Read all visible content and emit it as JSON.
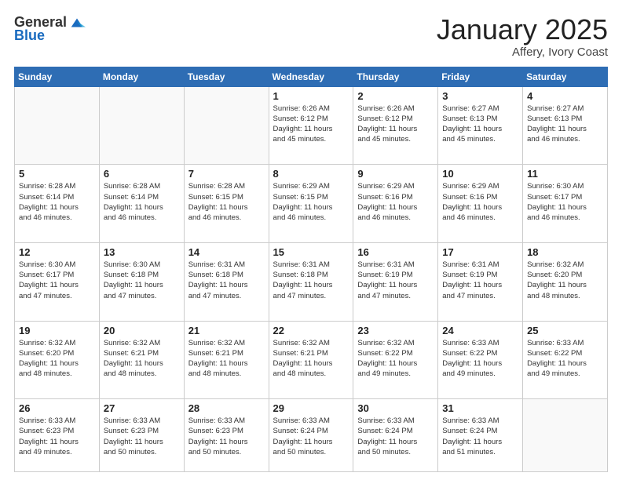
{
  "header": {
    "logo_general": "General",
    "logo_blue": "Blue",
    "title": "January 2025",
    "location": "Affery, Ivory Coast"
  },
  "weekdays": [
    "Sunday",
    "Monday",
    "Tuesday",
    "Wednesday",
    "Thursday",
    "Friday",
    "Saturday"
  ],
  "weeks": [
    [
      {
        "day": "",
        "info": ""
      },
      {
        "day": "",
        "info": ""
      },
      {
        "day": "",
        "info": ""
      },
      {
        "day": "1",
        "info": "Sunrise: 6:26 AM\nSunset: 6:12 PM\nDaylight: 11 hours\nand 45 minutes."
      },
      {
        "day": "2",
        "info": "Sunrise: 6:26 AM\nSunset: 6:12 PM\nDaylight: 11 hours\nand 45 minutes."
      },
      {
        "day": "3",
        "info": "Sunrise: 6:27 AM\nSunset: 6:13 PM\nDaylight: 11 hours\nand 45 minutes."
      },
      {
        "day": "4",
        "info": "Sunrise: 6:27 AM\nSunset: 6:13 PM\nDaylight: 11 hours\nand 46 minutes."
      }
    ],
    [
      {
        "day": "5",
        "info": "Sunrise: 6:28 AM\nSunset: 6:14 PM\nDaylight: 11 hours\nand 46 minutes."
      },
      {
        "day": "6",
        "info": "Sunrise: 6:28 AM\nSunset: 6:14 PM\nDaylight: 11 hours\nand 46 minutes."
      },
      {
        "day": "7",
        "info": "Sunrise: 6:28 AM\nSunset: 6:15 PM\nDaylight: 11 hours\nand 46 minutes."
      },
      {
        "day": "8",
        "info": "Sunrise: 6:29 AM\nSunset: 6:15 PM\nDaylight: 11 hours\nand 46 minutes."
      },
      {
        "day": "9",
        "info": "Sunrise: 6:29 AM\nSunset: 6:16 PM\nDaylight: 11 hours\nand 46 minutes."
      },
      {
        "day": "10",
        "info": "Sunrise: 6:29 AM\nSunset: 6:16 PM\nDaylight: 11 hours\nand 46 minutes."
      },
      {
        "day": "11",
        "info": "Sunrise: 6:30 AM\nSunset: 6:17 PM\nDaylight: 11 hours\nand 46 minutes."
      }
    ],
    [
      {
        "day": "12",
        "info": "Sunrise: 6:30 AM\nSunset: 6:17 PM\nDaylight: 11 hours\nand 47 minutes."
      },
      {
        "day": "13",
        "info": "Sunrise: 6:30 AM\nSunset: 6:18 PM\nDaylight: 11 hours\nand 47 minutes."
      },
      {
        "day": "14",
        "info": "Sunrise: 6:31 AM\nSunset: 6:18 PM\nDaylight: 11 hours\nand 47 minutes."
      },
      {
        "day": "15",
        "info": "Sunrise: 6:31 AM\nSunset: 6:18 PM\nDaylight: 11 hours\nand 47 minutes."
      },
      {
        "day": "16",
        "info": "Sunrise: 6:31 AM\nSunset: 6:19 PM\nDaylight: 11 hours\nand 47 minutes."
      },
      {
        "day": "17",
        "info": "Sunrise: 6:31 AM\nSunset: 6:19 PM\nDaylight: 11 hours\nand 47 minutes."
      },
      {
        "day": "18",
        "info": "Sunrise: 6:32 AM\nSunset: 6:20 PM\nDaylight: 11 hours\nand 48 minutes."
      }
    ],
    [
      {
        "day": "19",
        "info": "Sunrise: 6:32 AM\nSunset: 6:20 PM\nDaylight: 11 hours\nand 48 minutes."
      },
      {
        "day": "20",
        "info": "Sunrise: 6:32 AM\nSunset: 6:21 PM\nDaylight: 11 hours\nand 48 minutes."
      },
      {
        "day": "21",
        "info": "Sunrise: 6:32 AM\nSunset: 6:21 PM\nDaylight: 11 hours\nand 48 minutes."
      },
      {
        "day": "22",
        "info": "Sunrise: 6:32 AM\nSunset: 6:21 PM\nDaylight: 11 hours\nand 48 minutes."
      },
      {
        "day": "23",
        "info": "Sunrise: 6:32 AM\nSunset: 6:22 PM\nDaylight: 11 hours\nand 49 minutes."
      },
      {
        "day": "24",
        "info": "Sunrise: 6:33 AM\nSunset: 6:22 PM\nDaylight: 11 hours\nand 49 minutes."
      },
      {
        "day": "25",
        "info": "Sunrise: 6:33 AM\nSunset: 6:22 PM\nDaylight: 11 hours\nand 49 minutes."
      }
    ],
    [
      {
        "day": "26",
        "info": "Sunrise: 6:33 AM\nSunset: 6:23 PM\nDaylight: 11 hours\nand 49 minutes."
      },
      {
        "day": "27",
        "info": "Sunrise: 6:33 AM\nSunset: 6:23 PM\nDaylight: 11 hours\nand 50 minutes."
      },
      {
        "day": "28",
        "info": "Sunrise: 6:33 AM\nSunset: 6:23 PM\nDaylight: 11 hours\nand 50 minutes."
      },
      {
        "day": "29",
        "info": "Sunrise: 6:33 AM\nSunset: 6:24 PM\nDaylight: 11 hours\nand 50 minutes."
      },
      {
        "day": "30",
        "info": "Sunrise: 6:33 AM\nSunset: 6:24 PM\nDaylight: 11 hours\nand 50 minutes."
      },
      {
        "day": "31",
        "info": "Sunrise: 6:33 AM\nSunset: 6:24 PM\nDaylight: 11 hours\nand 51 minutes."
      },
      {
        "day": "",
        "info": ""
      }
    ]
  ]
}
